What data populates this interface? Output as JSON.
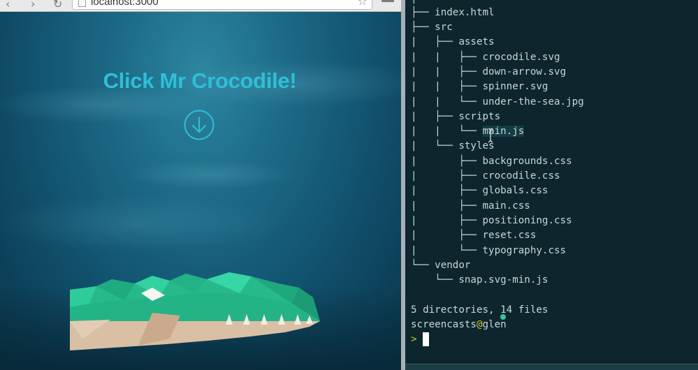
{
  "browser": {
    "url": "localhost:3000",
    "headline": "Click Mr Crocodile!",
    "nav": {
      "back_icon": "back-arrow-icon",
      "forward_icon": "forward-arrow-icon",
      "reload_icon": "reload-icon"
    },
    "colors": {
      "headline": "#2fbfd8",
      "croc_green": "#27b98c",
      "croc_tan": "#d9bfa4",
      "water": "#1d6c88"
    }
  },
  "terminal": {
    "tree": [
      {
        "prefix": "├── ",
        "name": "index.html"
      },
      {
        "prefix": "├── ",
        "name": "src"
      },
      {
        "prefix": "|   ├── ",
        "name": "assets"
      },
      {
        "prefix": "|   |   ├── ",
        "name": "crocodile.svg"
      },
      {
        "prefix": "|   |   ├── ",
        "name": "down-arrow.svg"
      },
      {
        "prefix": "|   |   ├── ",
        "name": "spinner.svg"
      },
      {
        "prefix": "|   |   └── ",
        "name": "under-the-sea.jpg"
      },
      {
        "prefix": "|   ├── ",
        "name": "scripts"
      },
      {
        "prefix": "|   |   └── ",
        "name": "main.js"
      },
      {
        "prefix": "|   └── ",
        "name": "styles"
      },
      {
        "prefix": "|       ├── ",
        "name": "backgrounds.css"
      },
      {
        "prefix": "|       ├── ",
        "name": "crocodile.css"
      },
      {
        "prefix": "|       ├── ",
        "name": "globals.css"
      },
      {
        "prefix": "|       ├── ",
        "name": "main.css"
      },
      {
        "prefix": "|       ├── ",
        "name": "positioning.css"
      },
      {
        "prefix": "|       ├── ",
        "name": "reset.css"
      },
      {
        "prefix": "|       └── ",
        "name": "typography.css"
      },
      {
        "prefix": "└── ",
        "name": "vendor"
      },
      {
        "prefix": "    └── ",
        "name": "snap.svg-min.js"
      }
    ],
    "summary": "5 directories, 14 files",
    "prompt_user": "screencasts",
    "prompt_at": "@",
    "prompt_host": "glen",
    "prompt_symbol": ">",
    "colors": {
      "background": "#0d262e",
      "text": "#c6d7d9",
      "accent": "#c7c72c"
    }
  }
}
